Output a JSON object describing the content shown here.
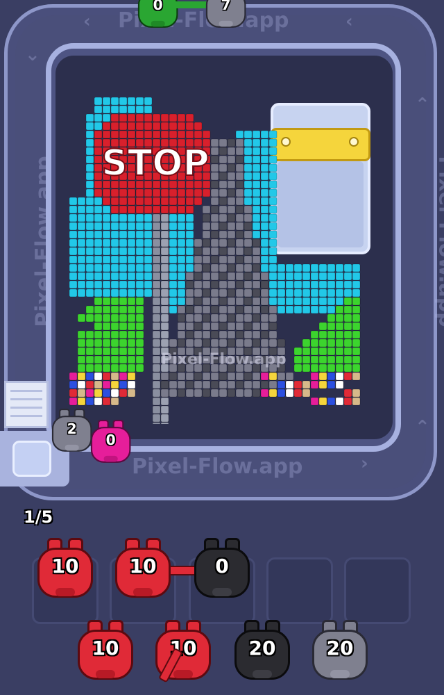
{
  "watermark": {
    "top": "Pixel-Flow.app",
    "bottom": "Pixel-Flow.app",
    "center": "Pixel-Flow.app",
    "left": "Pixel-Flow.app",
    "right": "Pixel-Flow.app"
  },
  "art_sign_text": "STOP",
  "queue_counter": "1/5",
  "conveyor_pigs": [
    {
      "color": "green",
      "count": "0"
    },
    {
      "color": "gray",
      "count": "7"
    }
  ],
  "dispenser_pigs": [
    {
      "color": "gray",
      "count": "2"
    },
    {
      "color": "pink",
      "count": "0"
    }
  ],
  "slot_row": [
    {
      "color": "red",
      "count": "10"
    },
    {
      "color": "red",
      "count": "10"
    },
    {
      "color": "black",
      "count": "0"
    },
    {
      "color": "empty",
      "count": ""
    },
    {
      "color": "empty",
      "count": ""
    }
  ],
  "reserve_row": [
    {
      "color": "red",
      "count": "10"
    },
    {
      "color": "red",
      "count": "10"
    },
    {
      "color": "black",
      "count": "20"
    },
    {
      "color": "gray",
      "count": "20"
    }
  ],
  "colors": {
    "background": "#3a3e63",
    "sky": "#22c8e8",
    "grass": "#3cd42e",
    "sign": "#d8202c",
    "tower": "#7a7b8c",
    "goal_bar": "#f5d53c"
  }
}
